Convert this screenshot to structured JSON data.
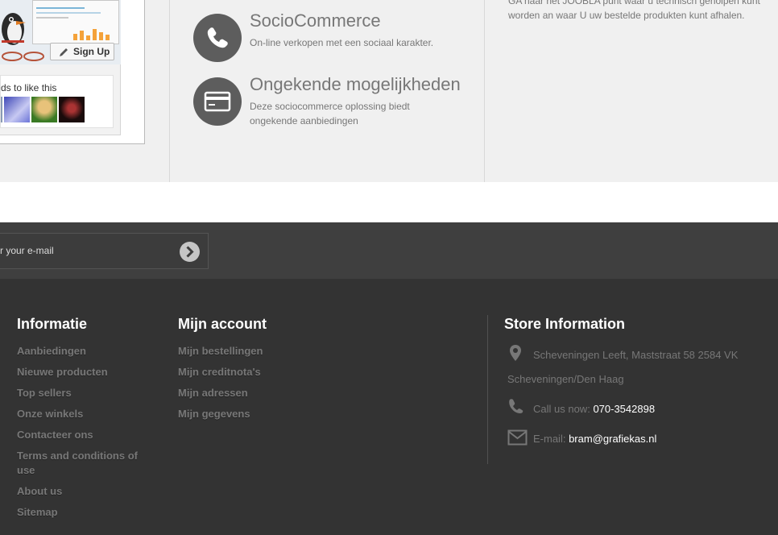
{
  "facebook_widget": {
    "signup_label": "Sign Up",
    "friends_text": "ds to like this"
  },
  "features": [
    {
      "icon": "phone-icon",
      "title": "SocioCommerce",
      "description": "On-line verkopen met een sociaal karakter."
    },
    {
      "icon": "credit-card-icon",
      "title": "Ongekende mogelijkheden",
      "description": "Deze sociocommerce oplossing biedt ongekende aanbiedingen"
    }
  ],
  "right_column_text": "GA naar het JOOBLA punt waar u technisch geholpen kunt worden an waar U uw bestelde produkten kunt afhalen.",
  "newsletter": {
    "placeholder": "r your e-mail",
    "submit_icon": "chevron-right-circle-icon"
  },
  "footer": {
    "informatie": {
      "heading": "Informatie",
      "links": [
        "Aanbiedingen",
        "Nieuwe producten",
        "Top sellers",
        "Onze winkels",
        "Contacteer ons",
        "Terms and conditions of use",
        "About us",
        "Sitemap"
      ]
    },
    "account": {
      "heading": "Mijn account",
      "links": [
        "Mijn bestellingen",
        "Mijn creditnota's",
        "Mijn adressen",
        "Mijn gegevens"
      ]
    },
    "store": {
      "heading": "Store Information",
      "address_line1": "Scheveningen Leeft, Maststraat 58 2584 VK",
      "address_line2": "Scheveningen/Den Haag",
      "call_label": "Call us now:",
      "phone": "070-3542898",
      "email_label": "E-mail:",
      "email": "bram@grafiekas.nl"
    }
  },
  "colors": {
    "top_band": "#f0f0f0",
    "newsletter_band": "#3f3f3f",
    "footer_bg": "#333333",
    "icon_circle": "#5d5d5d",
    "link_grey": "#777777"
  }
}
